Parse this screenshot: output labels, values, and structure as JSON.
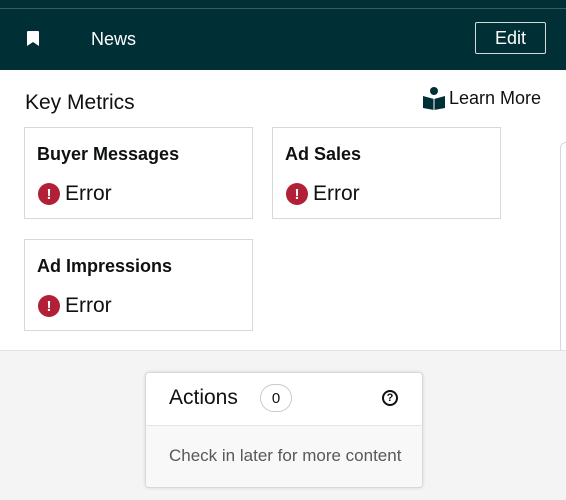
{
  "header": {
    "title": "News",
    "edit_label": "Edit",
    "bookmark_icon": "bookmark-icon",
    "background_color": "#002f36"
  },
  "metrics": {
    "title": "Key Metrics",
    "learn_more_label": "Learn More",
    "learn_more_icon": "reader-icon",
    "cards": [
      {
        "title": "Buyer Messages",
        "status": "Error"
      },
      {
        "title": "Ad Sales",
        "status": "Error"
      },
      {
        "title": "Ad Impressions",
        "status": "Error"
      }
    ],
    "error_icon": "exclamation-circle-icon",
    "error_color": "#b12036"
  },
  "actions": {
    "title": "Actions",
    "count": "0",
    "help_icon": "question-circle-icon",
    "message": "Check in later for more content"
  }
}
